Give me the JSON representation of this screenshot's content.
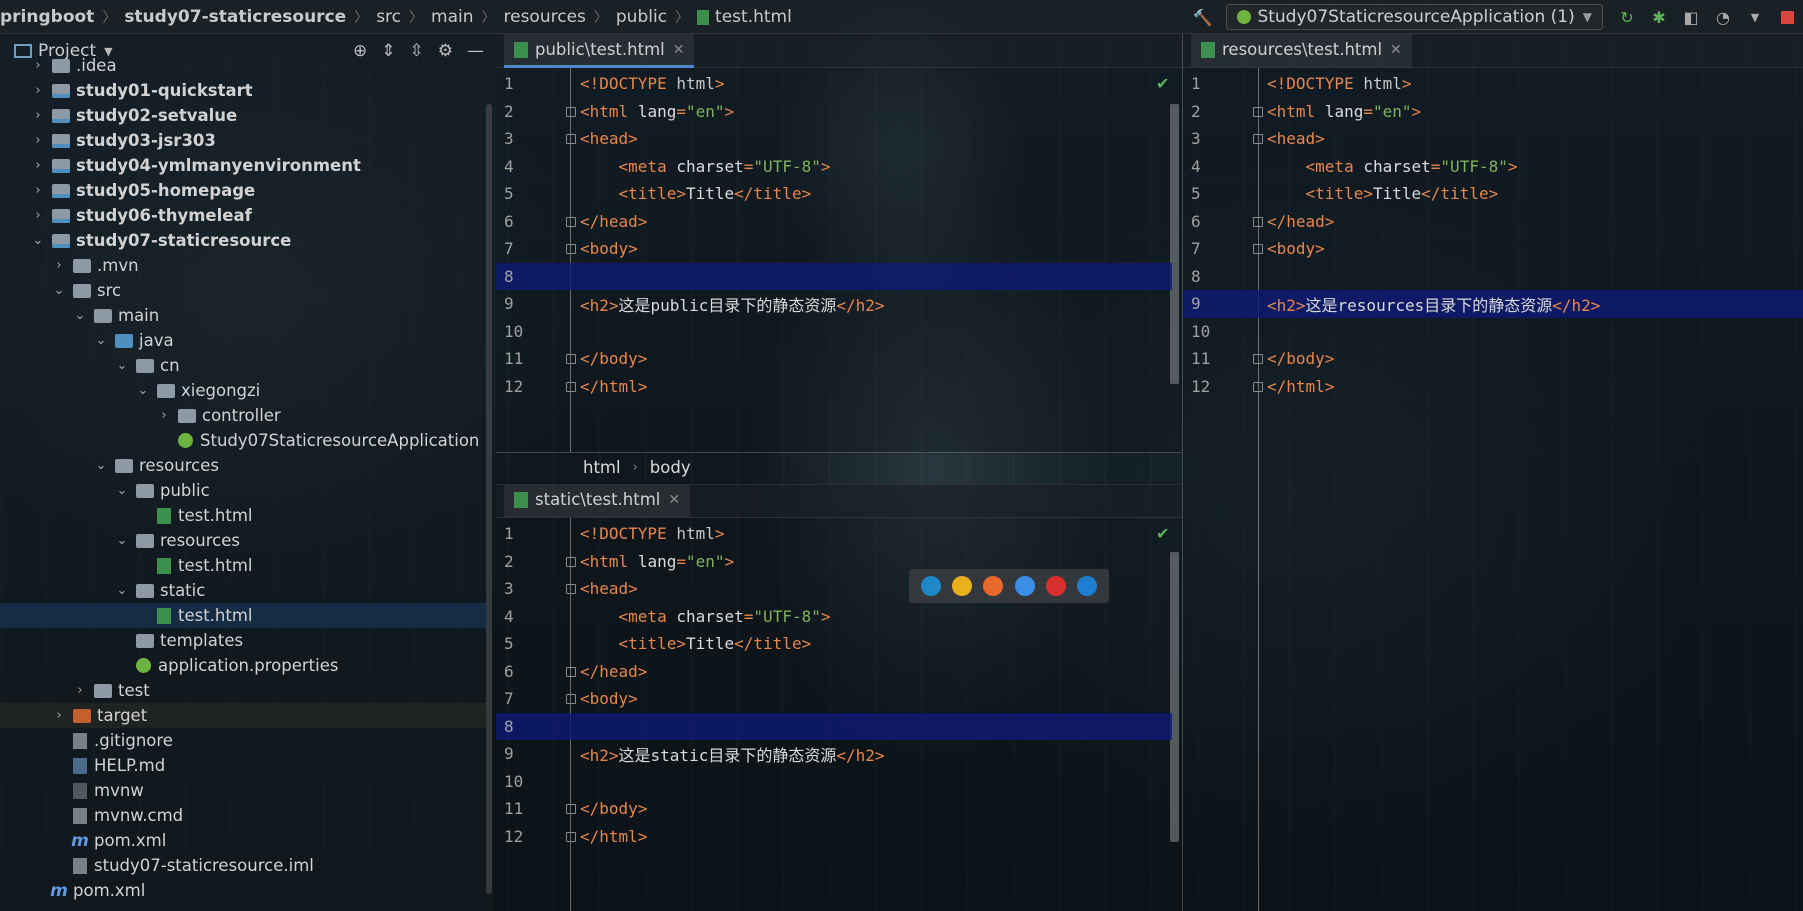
{
  "navbar": {
    "crumbs": [
      "pringboot",
      "study07-staticresource",
      "src",
      "main",
      "resources",
      "public",
      "test.html"
    ],
    "run_config": "Study07StaticresourceApplication (1)"
  },
  "project": {
    "title": "Project",
    "tree": [
      {
        "label": ".idea",
        "depth": 0,
        "icon": "folder",
        "arrow": "right"
      },
      {
        "label": "study01-quickstart",
        "depth": 0,
        "icon": "module",
        "arrow": "right",
        "bold": true
      },
      {
        "label": "study02-setvalue",
        "depth": 0,
        "icon": "module",
        "arrow": "right",
        "bold": true
      },
      {
        "label": "study03-jsr303",
        "depth": 0,
        "icon": "module",
        "arrow": "right",
        "bold": true
      },
      {
        "label": "study04-ymlmanyenvironment",
        "depth": 0,
        "icon": "module",
        "arrow": "right",
        "bold": true
      },
      {
        "label": "study05-homepage",
        "depth": 0,
        "icon": "module",
        "arrow": "right",
        "bold": true
      },
      {
        "label": "study06-thymeleaf",
        "depth": 0,
        "icon": "module",
        "arrow": "right",
        "bold": true
      },
      {
        "label": "study07-staticresource",
        "depth": 0,
        "icon": "module",
        "arrow": "down",
        "bold": true
      },
      {
        "label": ".mvn",
        "depth": 1,
        "icon": "folder",
        "arrow": "right"
      },
      {
        "label": "src",
        "depth": 1,
        "icon": "folder",
        "arrow": "down"
      },
      {
        "label": "main",
        "depth": 2,
        "icon": "folder",
        "arrow": "down"
      },
      {
        "label": "java",
        "depth": 3,
        "icon": "blue",
        "arrow": "down"
      },
      {
        "label": "cn",
        "depth": 4,
        "icon": "folder",
        "arrow": "down"
      },
      {
        "label": "xiegongzi",
        "depth": 5,
        "icon": "folder",
        "arrow": "down"
      },
      {
        "label": "controller",
        "depth": 6,
        "icon": "folder",
        "arrow": "right"
      },
      {
        "label": "Study07StaticresourceApplication",
        "depth": 6,
        "icon": "spring",
        "arrow": "none"
      },
      {
        "label": "resources",
        "depth": 3,
        "icon": "res",
        "arrow": "down"
      },
      {
        "label": "public",
        "depth": 4,
        "icon": "folder",
        "arrow": "down"
      },
      {
        "label": "test.html",
        "depth": 5,
        "icon": "html",
        "arrow": "none"
      },
      {
        "label": "resources",
        "depth": 4,
        "icon": "folder",
        "arrow": "down"
      },
      {
        "label": "test.html",
        "depth": 5,
        "icon": "html",
        "arrow": "none"
      },
      {
        "label": "static",
        "depth": 4,
        "icon": "folder",
        "arrow": "down"
      },
      {
        "label": "test.html",
        "depth": 5,
        "icon": "html",
        "arrow": "none",
        "selected": true
      },
      {
        "label": "templates",
        "depth": 4,
        "icon": "folder",
        "arrow": "none"
      },
      {
        "label": "application.properties",
        "depth": 4,
        "icon": "spring",
        "arrow": "none"
      },
      {
        "label": "test",
        "depth": 2,
        "icon": "folder",
        "arrow": "right"
      },
      {
        "label": "target",
        "depth": 1,
        "icon": "orange",
        "arrow": "right",
        "target": true
      },
      {
        "label": ".gitignore",
        "depth": 1,
        "icon": "git",
        "arrow": "none"
      },
      {
        "label": "HELP.md",
        "depth": 1,
        "icon": "md",
        "arrow": "none"
      },
      {
        "label": "mvnw",
        "depth": 1,
        "icon": "sh",
        "arrow": "none"
      },
      {
        "label": "mvnw.cmd",
        "depth": 1,
        "icon": "git",
        "arrow": "none"
      },
      {
        "label": "pom.xml",
        "depth": 1,
        "icon": "maven",
        "arrow": "none"
      },
      {
        "label": "study07-staticresource.iml",
        "depth": 1,
        "icon": "git",
        "arrow": "none"
      },
      {
        "label": "pom.xml",
        "depth": 0,
        "icon": "maven",
        "arrow": "none"
      }
    ]
  },
  "editors": {
    "public": {
      "tab": "public\\test.html",
      "highlight": 8,
      "h2_text": "这是public目录下的静态资源",
      "breadcrumbs": [
        "html",
        "body"
      ]
    },
    "static": {
      "tab": "static\\test.html",
      "highlight": 8,
      "h2_text": "这是static目录下的静态资源"
    },
    "resources": {
      "tab": "resources\\test.html",
      "highlight": 9,
      "h2_text": "这是resources目录下的静态资源"
    }
  },
  "code_lines": [
    "<!DOCTYPE html>",
    "<html lang=\"en\">",
    "<head>",
    "    <meta charset=\"UTF-8\">",
    "    <title>Title</title>",
    "</head>",
    "<body>",
    "",
    "<h2>__H2__</h2>",
    "",
    "</body>",
    "</html>"
  ],
  "browser_icons": [
    "edge-icon",
    "chrome-icon",
    "firefox-icon",
    "safari-icon",
    "opera-icon",
    "ie-icon"
  ]
}
